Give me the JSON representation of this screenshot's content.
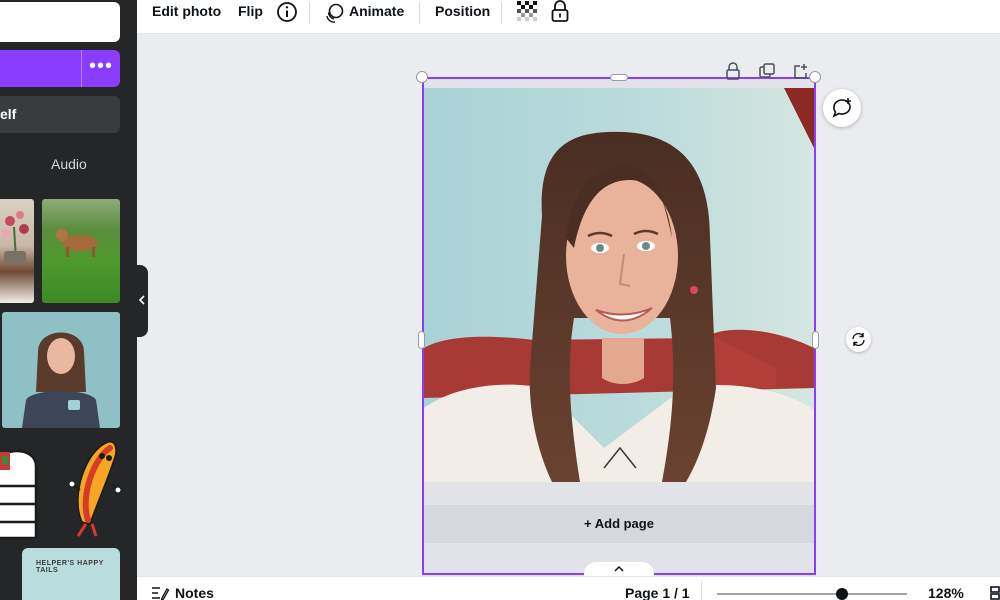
{
  "sidebar": {
    "self_label": "elf",
    "menu_dots": "•••",
    "audio_tab": "Audio",
    "sticker_text": "HELPER'S HAPPY TAILS"
  },
  "toolbar": {
    "edit_photo": "Edit photo",
    "flip": "Flip",
    "animate": "Animate",
    "position": "Position"
  },
  "canvas": {
    "add_page": "+ Add page"
  },
  "bottom": {
    "notes": "Notes",
    "page_indicator": "Page 1 / 1",
    "zoom": "128%",
    "zoom_value": 0.66
  },
  "colors": {
    "accent": "#8b3dff",
    "sidebar_bg": "#252627",
    "canvas_bg": "#ebecf0"
  }
}
